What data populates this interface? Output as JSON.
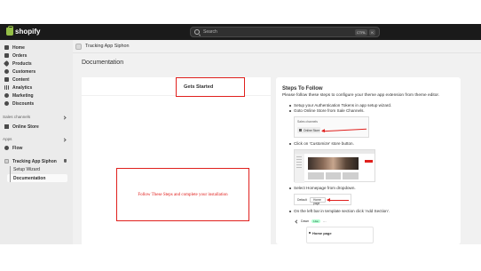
{
  "topbar": {
    "brand": "shopify",
    "search_placeholder": "Search",
    "shortcut": [
      "CTRL",
      "K"
    ]
  },
  "sidebar": {
    "items": [
      {
        "label": "Home",
        "icon": "home-icon"
      },
      {
        "label": "Orders",
        "icon": "orders-icon"
      },
      {
        "label": "Products",
        "icon": "tag-icon"
      },
      {
        "label": "Customers",
        "icon": "person-icon"
      },
      {
        "label": "Content",
        "icon": "content-icon"
      },
      {
        "label": "Analytics",
        "icon": "bar-chart-icon"
      },
      {
        "label": "Marketing",
        "icon": "target-icon"
      },
      {
        "label": "Discounts",
        "icon": "discount-icon"
      }
    ],
    "sales_channels_label": "Sales channels",
    "online_store": "Online Store",
    "apps_label": "Apps",
    "flow": "Flow",
    "app_name": "Tracking App Siphon",
    "sub_items": [
      "Setup Wizard",
      "Documentation"
    ]
  },
  "main": {
    "app_header": "Tracking App Siphon",
    "page_title": "Documentation",
    "gets_started": "Gets Started",
    "follow_note": "Follow These Steps and complete your installation",
    "steps": {
      "title": "Steps To Follow",
      "intro": "Please follow these steps to configure your theme app extension from theme editor.",
      "items": [
        "Setup your Authentication Tokens in app setup wizard.",
        "Goto Online Store from Sale Channels.",
        "Click on 'Customize' store button.",
        "Select Homepage from dropdown.",
        "On the left bar in template section click 'Add Section'."
      ]
    },
    "shots": {
      "sales_channels_label": "Sales channels",
      "online_store": "Online Store",
      "default_label": "Default",
      "home_page": "Home page",
      "dawn_label": "Dawn",
      "live_badge": "Live",
      "more": "···",
      "home_page_panel": "Home page"
    }
  },
  "colors": {
    "accent_red": "#e0201d",
    "topbar": "#1a1a1a",
    "brand_green": "#95bf47"
  }
}
